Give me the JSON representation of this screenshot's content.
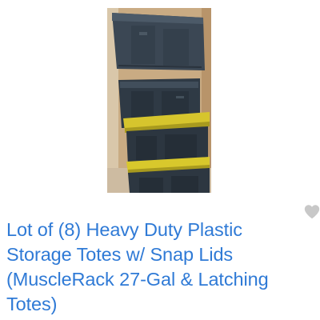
{
  "listing": {
    "title": "Lot of (8) Heavy Duty Plastic Storage Totes w/ Snap Lids (MuscleRack 27-Gal & Latching Totes)",
    "photo_icon": "product-photo",
    "favorite_icon": "heart-icon"
  },
  "colors": {
    "title": "#2f7ad6",
    "heart": "#c8c8c8",
    "tote_body": "#33404d",
    "tote_lid_yellow": "#d8c62a",
    "wall": "#c7a77f"
  }
}
